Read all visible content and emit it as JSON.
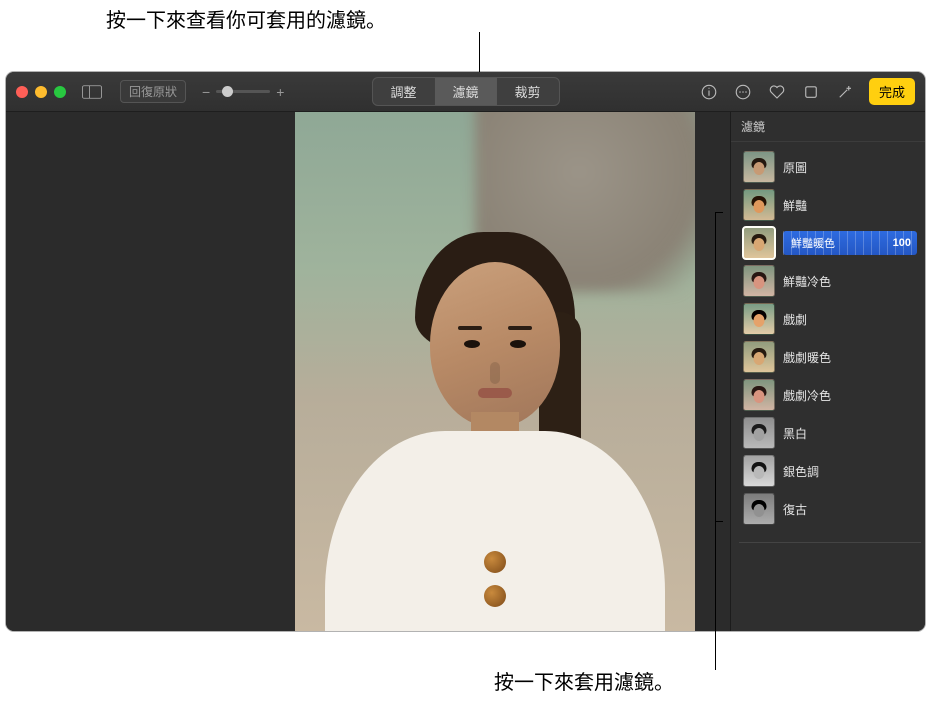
{
  "callouts": {
    "top": "按一下來查看你可套用的濾鏡。",
    "bottom": "按一下來套用濾鏡。"
  },
  "toolbar": {
    "revert_label": "回復原狀",
    "segments": {
      "adjust": "調整",
      "filters": "濾鏡",
      "crop": "裁剪"
    },
    "done_label": "完成"
  },
  "panel": {
    "title": "濾鏡",
    "selected_index": 2,
    "selected_value": 100,
    "filters": [
      {
        "label": "原圖",
        "variant": ""
      },
      {
        "label": "鮮豔",
        "variant": "vivid"
      },
      {
        "label": "鮮豔暖色",
        "variant": "warm"
      },
      {
        "label": "鮮豔冷色",
        "variant": "cool"
      },
      {
        "label": "戲劇",
        "variant": "drama"
      },
      {
        "label": "戲劇暖色",
        "variant": "warm"
      },
      {
        "label": "戲劇冷色",
        "variant": "cool"
      },
      {
        "label": "黑白",
        "variant": "bw"
      },
      {
        "label": "銀色調",
        "variant": "silver"
      },
      {
        "label": "復古",
        "variant": "noir"
      }
    ]
  }
}
